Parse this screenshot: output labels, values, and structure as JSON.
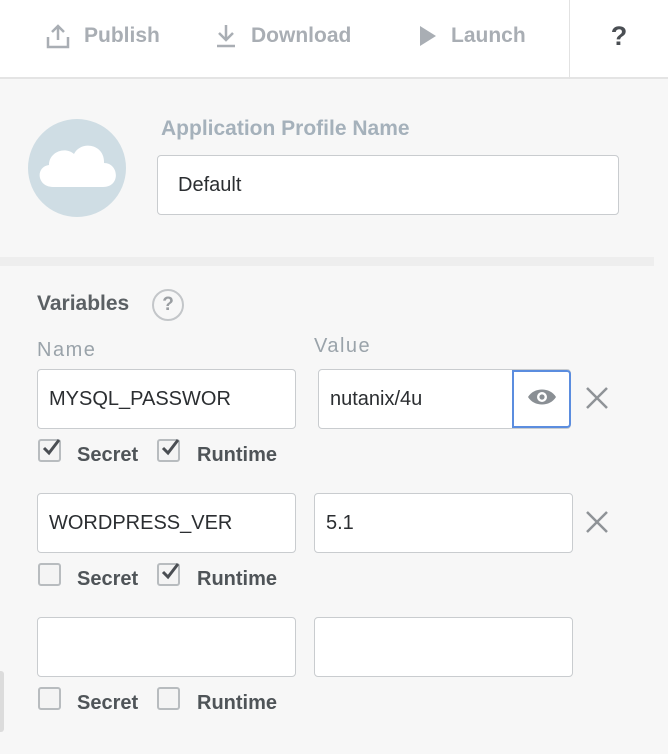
{
  "toolbar": {
    "publish_label": "Publish",
    "download_label": "Download",
    "launch_label": "Launch",
    "help_label": "?"
  },
  "profile": {
    "label": "Application Profile Name",
    "value": "Default"
  },
  "variables": {
    "title": "Variables",
    "help": "?",
    "name_header": "Name",
    "value_header": "Value",
    "secret_label": "Secret",
    "runtime_label": "Runtime",
    "rows": [
      {
        "name": "MYSQL_PASSWOR",
        "value": "nutanix/4u",
        "secret": true,
        "runtime": true
      },
      {
        "name": "WORDPRESS_VER",
        "value": "5.1",
        "secret": false,
        "runtime": true
      },
      {
        "name": "",
        "value": "",
        "secret": false,
        "runtime": false
      }
    ]
  },
  "colors": {
    "toolbar_text": "#a9aeb4",
    "avatar_bg": "#cfdde4",
    "label_text": "#a5b1bb",
    "eye_border": "#5b8ddf"
  },
  "icons": [
    "upload-icon",
    "download-icon",
    "play-icon",
    "cloud-icon",
    "eye-icon",
    "close-icon",
    "checkmark-icon"
  ]
}
